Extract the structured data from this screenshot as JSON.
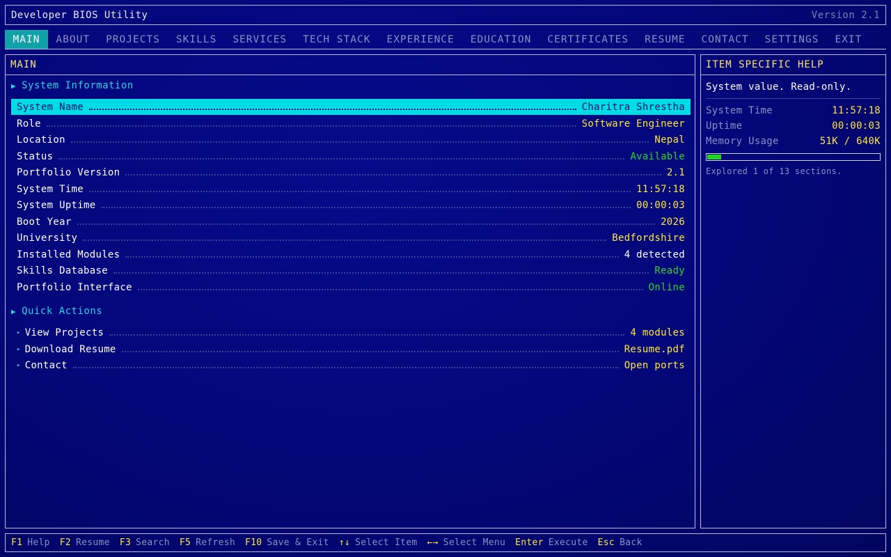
{
  "window": {
    "title": "Developer BIOS Utility",
    "version": "Version 2.1"
  },
  "menu": [
    {
      "label": "MAIN",
      "active": true
    },
    {
      "label": "ABOUT"
    },
    {
      "label": "PROJECTS"
    },
    {
      "label": "SKILLS"
    },
    {
      "label": "SERVICES"
    },
    {
      "label": "TECH STACK"
    },
    {
      "label": "EXPERIENCE"
    },
    {
      "label": "EDUCATION"
    },
    {
      "label": "CERTIFICATES"
    },
    {
      "label": "RESUME"
    },
    {
      "label": "CONTACT"
    },
    {
      "label": "SETTINGS"
    },
    {
      "label": "EXIT"
    }
  ],
  "main": {
    "title": "MAIN",
    "system_info_heading": "System Information",
    "system_info": [
      {
        "label": "System Name",
        "value": "Charitra Shrestha",
        "color": "yellow"
      },
      {
        "label": "Role",
        "value": "Software Engineer",
        "color": "yellow"
      },
      {
        "label": "Location",
        "value": "Nepal",
        "color": "yellow"
      },
      {
        "label": "Status",
        "value": "Available",
        "color": "green"
      },
      {
        "label": "Portfolio Version",
        "value": "2.1",
        "color": "yellow"
      },
      {
        "label": "System Time",
        "value": "11:57:18",
        "color": "yellow"
      },
      {
        "label": "System Uptime",
        "value": "00:00:03",
        "color": "yellow"
      },
      {
        "label": "Boot Year",
        "value": "2026",
        "color": "yellow"
      },
      {
        "label": "University",
        "value": "Bedfordshire",
        "color": "yellow"
      },
      {
        "label": "Installed Modules",
        "value": "4 detected",
        "color": "white"
      },
      {
        "label": "Skills Database",
        "value": "Ready",
        "color": "green"
      },
      {
        "label": "Portfolio Interface",
        "value": "Online",
        "color": "green"
      }
    ],
    "quick_actions_heading": "Quick Actions",
    "quick_actions": [
      {
        "label": "View Projects",
        "value": "4 modules"
      },
      {
        "label": "Download Resume",
        "value": "Resume.pdf"
      },
      {
        "label": "Contact",
        "value": "Open ports"
      }
    ]
  },
  "help": {
    "title": "ITEM SPECIFIC HELP",
    "description": "System value. Read-only.",
    "system_time_label": "System Time",
    "system_time": "11:57:18",
    "uptime_label": "Uptime",
    "uptime": "00:00:03",
    "memory_label": "Memory Usage",
    "memory": "51K / 640K",
    "memory_fraction": 0.08,
    "explored": "Explored 1 of 13 sections."
  },
  "footer": [
    {
      "key": "F1",
      "desc": "Help"
    },
    {
      "key": "F2",
      "desc": "Resume"
    },
    {
      "key": "F3",
      "desc": "Search"
    },
    {
      "key": "F5",
      "desc": "Refresh"
    },
    {
      "key": "F10",
      "desc": "Save & Exit"
    },
    {
      "key": "↑↓",
      "desc": "Select Item"
    },
    {
      "key": "←→",
      "desc": "Select Menu"
    },
    {
      "key": "Enter",
      "desc": "Execute"
    },
    {
      "key": "Esc",
      "desc": "Back"
    }
  ],
  "colors": {
    "background": "#03077a",
    "accent_cyan": "#00dce6",
    "menu_active": "#11a1a8",
    "value_yellow": "#ffe740",
    "value_green": "#28d628",
    "header_yellow": "#ffe66d"
  }
}
